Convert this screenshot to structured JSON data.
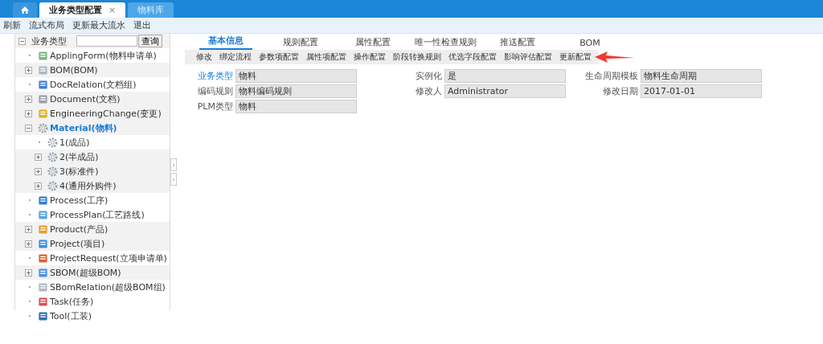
{
  "window_tabs": [
    {
      "kind": "home",
      "selected": false
    },
    {
      "kind": "text",
      "label": "业务类型配置",
      "close": "×",
      "selected": true
    },
    {
      "kind": "text",
      "label": "物料库",
      "selected": false
    }
  ],
  "menu": [
    "刷新",
    "流式布局",
    "更新最大流水",
    "退出"
  ],
  "tree": {
    "root": "业务类型",
    "expanded": true,
    "search_button": "查询",
    "items": [
      {
        "label": "ApplingForm(物料申请单)",
        "kind": "form",
        "expandable": false,
        "selected": false
      },
      {
        "label": "BOM(BOM)",
        "kind": "bottle",
        "expandable": true,
        "expanded": false,
        "selected": false
      },
      {
        "label": "DocRelation(文档组)",
        "kind": "table",
        "expandable": false,
        "selected": false
      },
      {
        "label": "Document(文档)",
        "kind": "doc",
        "expandable": true,
        "expanded": false,
        "selected": false
      },
      {
        "label": "EngineeringChange(变更)",
        "kind": "ruler",
        "expandable": true,
        "expanded": false,
        "selected": false
      },
      {
        "label": "Material(物料)",
        "kind": "gear",
        "expandable": true,
        "expanded": true,
        "selected": true,
        "children": [
          {
            "label": "1(成品)",
            "kind": "gear",
            "expandable": false,
            "selected": false
          },
          {
            "label": "2(半成品)",
            "kind": "gear",
            "expandable": true,
            "expanded": false,
            "selected": false
          },
          {
            "label": "3(标准件)",
            "kind": "gear",
            "expandable": true,
            "expanded": false,
            "selected": false
          },
          {
            "label": "4(通用外购件)",
            "kind": "gear",
            "expandable": true,
            "expanded": false,
            "selected": false
          }
        ]
      },
      {
        "label": "Process(工序)",
        "kind": "wrench",
        "expandable": false,
        "selected": false
      },
      {
        "label": "ProcessPlan(工艺路线)",
        "kind": "chart",
        "expandable": false,
        "selected": false
      },
      {
        "label": "Product(产品)",
        "kind": "truck",
        "expandable": true,
        "expanded": false,
        "selected": false
      },
      {
        "label": "Project(项目)",
        "kind": "folder",
        "expandable": true,
        "expanded": false,
        "selected": false
      },
      {
        "label": "ProjectRequest(立项申请单)",
        "kind": "note",
        "expandable": false,
        "selected": false
      },
      {
        "label": "SBOM(超级BOM)",
        "kind": "clipboard",
        "expandable": true,
        "expanded": false,
        "selected": false
      },
      {
        "label": "SBomRelation(超级BOM组)",
        "kind": "bottle",
        "expandable": false,
        "selected": false
      },
      {
        "label": "Task(任务)",
        "kind": "list",
        "expandable": false,
        "selected": false
      },
      {
        "label": "Tool(工装)",
        "kind": "tray",
        "expandable": false,
        "selected": false
      }
    ]
  },
  "splitter": {
    "expand": "›",
    "collapse": "‹"
  },
  "tabs": [
    {
      "label": "基本信息",
      "selected": true
    },
    {
      "label": "规则配置",
      "selected": false
    },
    {
      "label": "属性配置",
      "selected": false
    },
    {
      "label": "唯一性检查规则",
      "selected": false
    },
    {
      "label": "推送配置",
      "selected": false
    },
    {
      "label": "BOM",
      "selected": false
    }
  ],
  "toolbar": [
    "修改",
    "绑定流程",
    "参数项配置",
    "属性项配置",
    "操作配置",
    "阶段转换规则",
    "优选字段配置",
    "影响评估配置",
    "更新配置"
  ],
  "form_columns": [
    [
      {
        "label": "业务类型",
        "value": "物料",
        "link": true
      },
      {
        "label": "编码规则",
        "value": "物料编码规则",
        "link": false
      },
      {
        "label": "PLM类型",
        "value": "物料",
        "link": false
      }
    ],
    [
      {
        "label": "实例化",
        "value": "是",
        "link": false
      },
      {
        "label": "修改人",
        "value": "Administrator",
        "link": false
      }
    ],
    [
      {
        "label": "生命周期模板",
        "value": "物料生命周期",
        "link": false
      },
      {
        "label": "修改日期",
        "value": "2017-01-01",
        "link": false
      }
    ]
  ]
}
